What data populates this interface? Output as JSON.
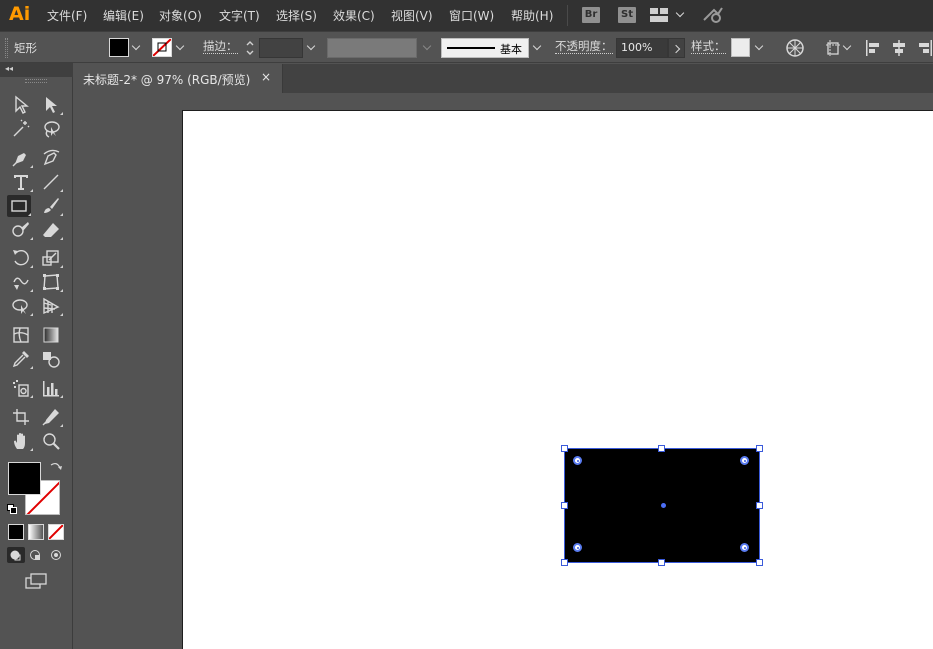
{
  "app": {
    "logo": "Ai"
  },
  "menubar": {
    "items": [
      "文件(F)",
      "编辑(E)",
      "对象(O)",
      "文字(T)",
      "选择(S)",
      "效果(C)",
      "视图(V)",
      "窗口(W)",
      "帮助(H)"
    ],
    "bridge_badge": "Br",
    "stock_badge": "St"
  },
  "controlbar": {
    "tool_name": "矩形",
    "stroke_label": "描边：",
    "stroke_profile": "基本",
    "opacity_label": "不透明度：",
    "opacity_value": "100%",
    "style_label": "样式："
  },
  "tabs": [
    {
      "title": "未标题-2* @ 97% (RGB/预览)",
      "close": "×"
    }
  ],
  "colors": {
    "fill": "#000000",
    "stroke": "none",
    "selection": "#3b5bdb",
    "artboard": "#ffffff"
  },
  "tools": [
    "selection",
    "direct-selection",
    "magic-wand",
    "lasso",
    "pen",
    "curvature",
    "type",
    "line-segment",
    "rectangle",
    "paintbrush",
    "shaper",
    "eraser",
    "rotate",
    "scale",
    "warp",
    "free-transform",
    "shape-builder",
    "perspective-grid",
    "mesh",
    "gradient",
    "eyedropper",
    "blend",
    "symbol-sprayer",
    "column-graph",
    "artboard",
    "slice",
    "hand",
    "zoom"
  ],
  "active_tool": "rectangle"
}
